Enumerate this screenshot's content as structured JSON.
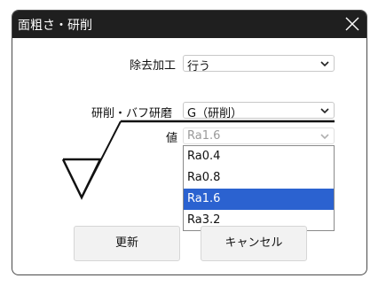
{
  "window": {
    "title": "面粗さ・研削"
  },
  "removal": {
    "label": "除去加工",
    "value": "行う"
  },
  "grinding": {
    "label": "研削・バフ研磨",
    "value": "G（研削）"
  },
  "roughness": {
    "label": "値",
    "value": "Ra1.6",
    "options": [
      "Ra0.4",
      "Ra0.8",
      "Ra1.6",
      "Ra3.2"
    ]
  },
  "buttons": {
    "update": "更新",
    "cancel": "キャンセル"
  },
  "colors": {
    "titlebar": "#1f1f1f",
    "selected": "#2b62d0"
  },
  "icons": {
    "close": "close-icon",
    "chevron": "chevron-down-icon"
  }
}
